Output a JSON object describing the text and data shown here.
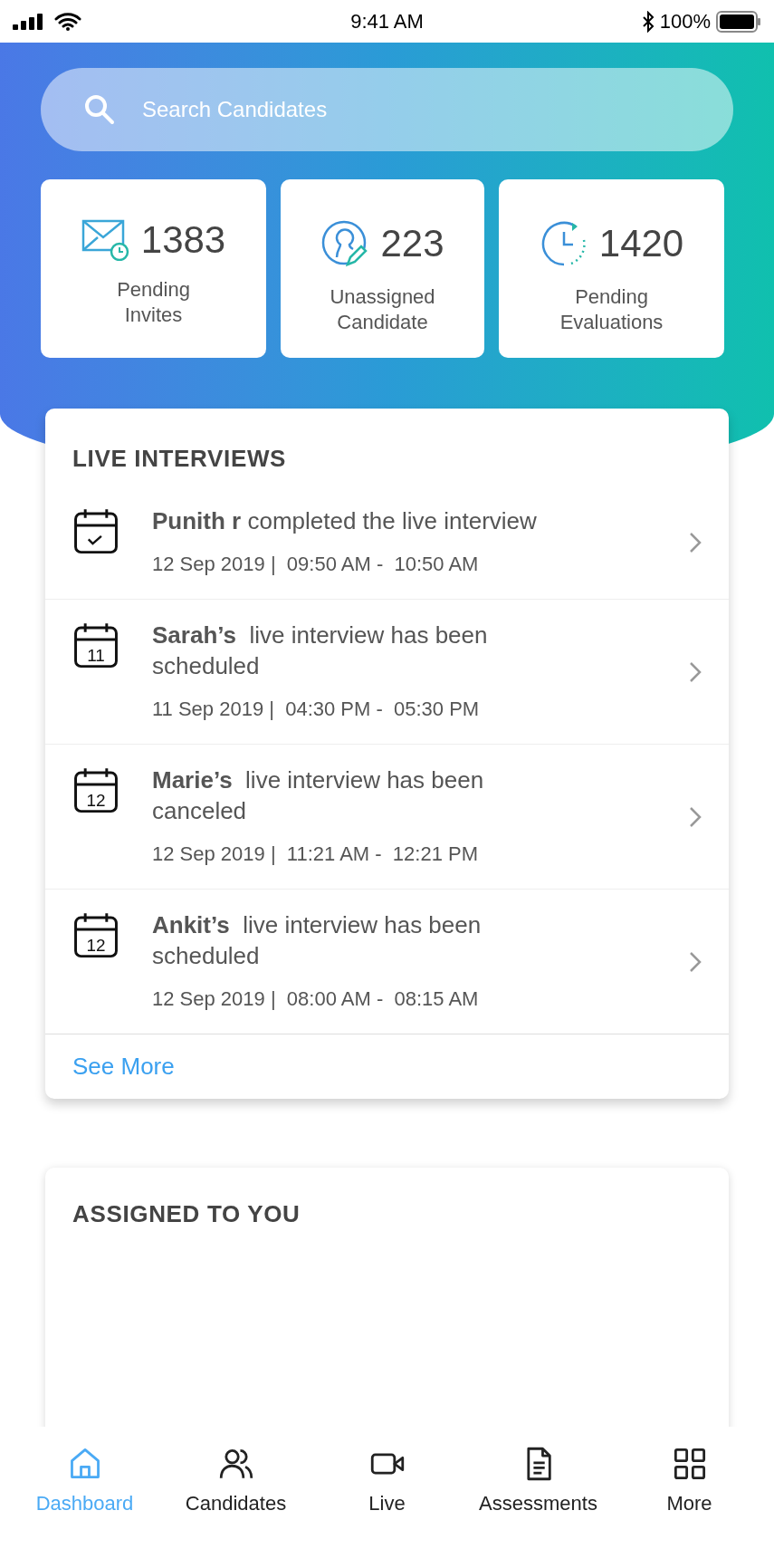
{
  "status_bar": {
    "time": "9:41 AM",
    "battery": "100%"
  },
  "search": {
    "placeholder": "Search Candidates"
  },
  "stats": [
    {
      "kind": "invites",
      "count": "1383",
      "label": "Pending Invites"
    },
    {
      "kind": "unassigned",
      "count": "223",
      "label": "Unassigned Candidate"
    },
    {
      "kind": "evaluations",
      "count": "1420",
      "label": "Pending Evaluations"
    }
  ],
  "live_interviews": {
    "title": "LIVE INTERVIEWS",
    "items": [
      {
        "icon": {
          "kind": "check"
        },
        "text": "**Punith r** completed the live interview",
        "time": "12 Sep 2019 |  09:50 AM -  10:50 AM"
      },
      {
        "icon": {
          "kind": "day",
          "day": "11"
        },
        "text": "**Sarah’s**  live interview has been scheduled",
        "time": "11 Sep 2019 |  04:30 PM -  05:30 PM"
      },
      {
        "icon": {
          "kind": "day",
          "day": "12"
        },
        "text": "**Marie’s**  live interview has been canceled",
        "time": "12 Sep 2019 |  11:21 AM -  12:21 PM"
      },
      {
        "icon": {
          "kind": "day",
          "day": "12"
        },
        "text": "**Ankit’s**  live interview has been scheduled",
        "time": "12 Sep 2019 |  08:00 AM -  08:15 AM"
      }
    ],
    "see_more": "See More"
  },
  "assigned": {
    "title": "ASSIGNED TO YOU"
  },
  "tab_bar": [
    {
      "kind": "home",
      "label": "Dashboard",
      "selected": true
    },
    {
      "kind": "people",
      "label": "Candidates",
      "selected": false
    },
    {
      "kind": "video",
      "label": "Live",
      "selected": false
    },
    {
      "kind": "document",
      "label": "Assessments",
      "selected": false
    },
    {
      "kind": "grid",
      "label": "More",
      "selected": false
    }
  ]
}
